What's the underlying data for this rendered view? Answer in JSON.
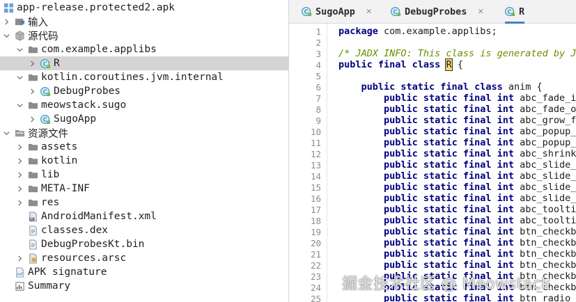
{
  "tree": {
    "title": "app-release.protected2.apk",
    "items": [
      {
        "label": "app-release.protected2.apk",
        "arrow": "",
        "icon": "apk-icon",
        "indent": 0
      },
      {
        "label": "输入",
        "arrow": "right",
        "icon": "input-icon",
        "indent": 0
      },
      {
        "label": "源代码",
        "arrow": "down",
        "icon": "source-code-icon",
        "indent": 0
      },
      {
        "label": "com.example.applibs",
        "arrow": "down",
        "icon": "package-icon",
        "indent": 1
      },
      {
        "label": "R",
        "arrow": "right",
        "icon": "class-icon",
        "indent": 2,
        "selected": true
      },
      {
        "label": "kotlin.coroutines.jvm.internal",
        "arrow": "down",
        "icon": "package-icon",
        "indent": 1
      },
      {
        "label": "DebugProbes",
        "arrow": "right",
        "icon": "class-icon",
        "indent": 2
      },
      {
        "label": "meowstack.sugo",
        "arrow": "down",
        "icon": "package-icon",
        "indent": 1
      },
      {
        "label": "SugoApp",
        "arrow": "right",
        "icon": "class-icon",
        "indent": 2
      },
      {
        "label": "资源文件",
        "arrow": "down",
        "icon": "resources-icon",
        "indent": 0
      },
      {
        "label": "assets",
        "arrow": "right",
        "icon": "folder-icon",
        "indent": 1
      },
      {
        "label": "kotlin",
        "arrow": "right",
        "icon": "folder-icon",
        "indent": 1
      },
      {
        "label": "lib",
        "arrow": "right",
        "icon": "folder-icon",
        "indent": 1
      },
      {
        "label": "META-INF",
        "arrow": "right",
        "icon": "folder-icon",
        "indent": 1
      },
      {
        "label": "res",
        "arrow": "right",
        "icon": "folder-icon",
        "indent": 1
      },
      {
        "label": "AndroidManifest.xml",
        "arrow": "",
        "icon": "manifest-file-icon",
        "indent": 1
      },
      {
        "label": "classes.dex",
        "arrow": "",
        "icon": "file-icon",
        "indent": 1
      },
      {
        "label": "DebugProbesKt.bin",
        "arrow": "",
        "icon": "file-icon",
        "indent": 1
      },
      {
        "label": "resources.arsc",
        "arrow": "right",
        "icon": "arsc-file-icon",
        "indent": 1
      },
      {
        "label": "APK signature",
        "arrow": "",
        "icon": "signature-icon",
        "indent": 0
      },
      {
        "label": "Summary",
        "arrow": "",
        "icon": "summary-icon",
        "indent": 0
      }
    ]
  },
  "tabs": [
    {
      "label": "SugoApp",
      "close": "✕",
      "active": false
    },
    {
      "label": "DebugProbes",
      "close": "✕",
      "active": false
    },
    {
      "label": "R",
      "close": "",
      "active": true
    }
  ],
  "editor": {
    "line_numbers": [
      "1",
      "2",
      "3",
      "4",
      "5",
      "6",
      "7",
      "8",
      "9",
      "10",
      "11",
      "12",
      "13",
      "14",
      "15",
      "16",
      "17",
      "18",
      "19",
      "20",
      "21",
      "22",
      "23",
      "24",
      "25"
    ],
    "lines": [
      [
        {
          "t": "package",
          "c": "kw"
        },
        {
          "t": " com.example.applibs;",
          "c": ""
        }
      ],
      [],
      [
        {
          "t": "/* JADX INFO: This class is generated by JADX */",
          "c": "cm"
        }
      ],
      [
        {
          "t": "public final class ",
          "c": "kw"
        },
        {
          "t": "R",
          "c": "caret"
        },
        {
          "t": " {",
          "c": ""
        }
      ],
      [],
      [
        {
          "t": "    "
        },
        {
          "t": "public static final class",
          "c": "kw"
        },
        {
          "t": " anim {",
          "c": ""
        }
      ],
      [
        {
          "t": "        "
        },
        {
          "t": "public static final int",
          "c": "kw"
        },
        {
          "t": " abc_fade_in",
          "c": ""
        }
      ],
      [
        {
          "t": "        "
        },
        {
          "t": "public static final int",
          "c": "kw"
        },
        {
          "t": " abc_fade_out",
          "c": ""
        }
      ],
      [
        {
          "t": "        "
        },
        {
          "t": "public static final int",
          "c": "kw"
        },
        {
          "t": " abc_grow_fade",
          "c": ""
        }
      ],
      [
        {
          "t": "        "
        },
        {
          "t": "public static final int",
          "c": "kw"
        },
        {
          "t": " abc_popup_enter",
          "c": ""
        }
      ],
      [
        {
          "t": "        "
        },
        {
          "t": "public static final int",
          "c": "kw"
        },
        {
          "t": " abc_popup_exit",
          "c": ""
        }
      ],
      [
        {
          "t": "        "
        },
        {
          "t": "public static final int",
          "c": "kw"
        },
        {
          "t": " abc_shrink_fade",
          "c": ""
        }
      ],
      [
        {
          "t": "        "
        },
        {
          "t": "public static final int",
          "c": "kw"
        },
        {
          "t": " abc_slide_in",
          "c": ""
        }
      ],
      [
        {
          "t": "        "
        },
        {
          "t": "public static final int",
          "c": "kw"
        },
        {
          "t": " abc_slide_in",
          "c": ""
        }
      ],
      [
        {
          "t": "        "
        },
        {
          "t": "public static final int",
          "c": "kw"
        },
        {
          "t": " abc_slide_out",
          "c": ""
        }
      ],
      [
        {
          "t": "        "
        },
        {
          "t": "public static final int",
          "c": "kw"
        },
        {
          "t": " abc_slide_out",
          "c": ""
        }
      ],
      [
        {
          "t": "        "
        },
        {
          "t": "public static final int",
          "c": "kw"
        },
        {
          "t": " abc_tooltip",
          "c": ""
        }
      ],
      [
        {
          "t": "        "
        },
        {
          "t": "public static final int",
          "c": "kw"
        },
        {
          "t": " abc_tooltip",
          "c": ""
        }
      ],
      [
        {
          "t": "        "
        },
        {
          "t": "public static final int",
          "c": "kw"
        },
        {
          "t": " btn_checkbox",
          "c": ""
        }
      ],
      [
        {
          "t": "        "
        },
        {
          "t": "public static final int",
          "c": "kw"
        },
        {
          "t": " btn_checkbox",
          "c": ""
        }
      ],
      [
        {
          "t": "        "
        },
        {
          "t": "public static final int",
          "c": "kw"
        },
        {
          "t": " btn_checkbox",
          "c": ""
        }
      ],
      [
        {
          "t": "        "
        },
        {
          "t": "public static final int",
          "c": "kw"
        },
        {
          "t": " btn_checkbox",
          "c": ""
        }
      ],
      [
        {
          "t": "        "
        },
        {
          "t": "public static final int",
          "c": "kw"
        },
        {
          "t": " btn_checkbox",
          "c": ""
        }
      ],
      [
        {
          "t": "        "
        },
        {
          "t": "public static final int",
          "c": "kw"
        },
        {
          "t": " btn_checkbox",
          "c": ""
        }
      ],
      [
        {
          "t": "        "
        },
        {
          "t": "public static final int",
          "c": "kw"
        },
        {
          "t": " btn_radio_to",
          "c": ""
        }
      ]
    ]
  },
  "watermark": "掘金技术社区 @ Meowstack",
  "colors": {
    "selection": "#d4d4d4",
    "keyword": "#000080",
    "comment": "#6a8c00",
    "tab_underline": "#4083c9",
    "folder": "#8c8c8c",
    "class_icon": "#3f9fbf"
  }
}
